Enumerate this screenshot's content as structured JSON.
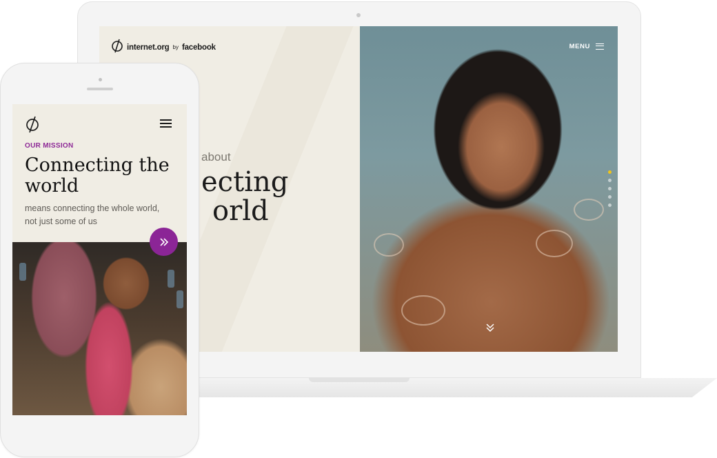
{
  "laptop": {
    "logo": {
      "brand": "internet.org",
      "by": "by",
      "partner": "facebook"
    },
    "menu_label": "MENU",
    "hero": {
      "eyebrow": "about",
      "title_line1": "ecting",
      "title_line2": "orld"
    },
    "slide_dots": {
      "count": 5,
      "active_index": 0
    },
    "colors": {
      "accent_dot": "#f0c419",
      "panel_bg": "#f0ede4"
    },
    "icons": [
      "internet-org-logo-icon",
      "menu-icon",
      "chevron-double-down-icon"
    ]
  },
  "phone": {
    "eyebrow": "OUR MISSION",
    "title": "Connecting the world",
    "subtitle": "means connecting the whole world, not just some of us",
    "icons": [
      "internet-org-logo-icon",
      "hamburger-icon",
      "double-chevron-right-icon"
    ],
    "colors": {
      "accent": "#8b2596",
      "eyebrow": "#8e2a97"
    }
  }
}
